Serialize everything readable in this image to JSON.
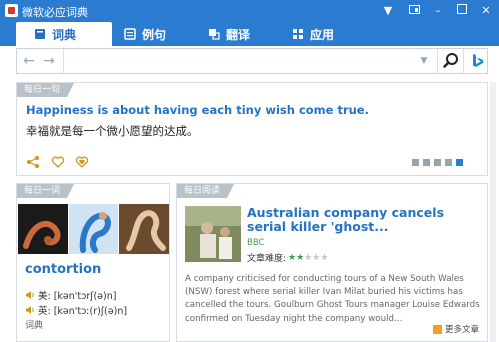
{
  "window": {
    "title": "微软必应词典",
    "controls": [
      "arrow-down",
      "restore-mini",
      "minimize",
      "maximize",
      "close"
    ]
  },
  "tabs": [
    {
      "label": "词典",
      "icon": "book-icon",
      "active": true
    },
    {
      "label": "例句",
      "icon": "sentences-icon",
      "active": false
    },
    {
      "label": "翻译",
      "icon": "translate-icon",
      "active": false
    },
    {
      "label": "应用",
      "icon": "apps-icon",
      "active": false
    }
  ],
  "search": {
    "value": "",
    "placeholder": ""
  },
  "daily_sentence": {
    "tag": "每日一句",
    "english": "Happiness is about having each tiny wish come true.",
    "chinese": "幸福就是每一个微小愿望的达成。",
    "page_count": 5,
    "active_page": 5
  },
  "daily_word": {
    "tag": "每日一词",
    "word": "contortion",
    "pron_us_label": "美: [kən'tɔrʃ(ə)n]",
    "pron_uk_label": "英: [kən'tɔː(r)ʃ(ə)n]",
    "footer": "词典"
  },
  "daily_reading": {
    "tag": "每日阅读",
    "title": "Australian company cancels serial killer 'ghost...",
    "source": "BBC",
    "difficulty_label": "文章难度:",
    "difficulty": 2,
    "difficulty_max": 5,
    "body": "A company criticised for conducting tours of a New South Wales (NSW) forest where serial killer Ivan Milat buried his victims has cancelled the tours. Goulburn Ghost Tours manager Louise Edwards confirmed on Tuesday night the company would...",
    "more_label": "更多文章"
  },
  "colors": {
    "accent": "#2b7bd0",
    "link": "#2473c4",
    "rating": "#3aa04a",
    "heart": "#d4941c"
  }
}
